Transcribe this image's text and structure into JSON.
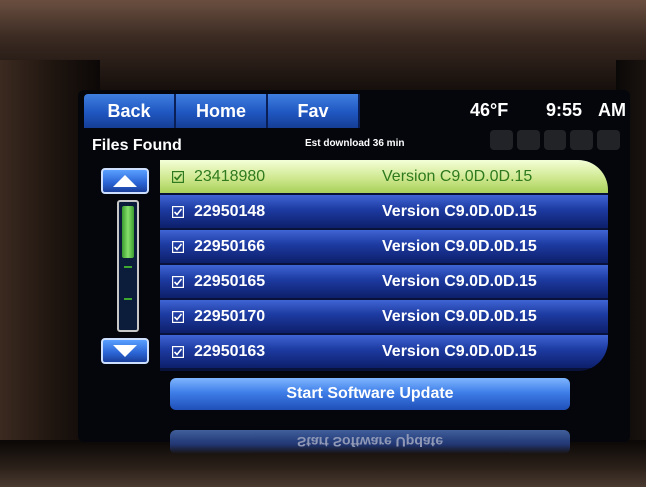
{
  "header": {
    "buttons": {
      "back": "Back",
      "home": "Home",
      "fav": "Fav"
    },
    "temperature": "46°F",
    "time": "9:55",
    "ampm": "AM"
  },
  "subheader": {
    "title": "Files Found",
    "est_download": "Est download 36 min"
  },
  "files": [
    {
      "id": "23418980",
      "version": "Version C9.0D.0D.15",
      "checked": true,
      "selected": true
    },
    {
      "id": "22950148",
      "version": "Version C9.0D.0D.15",
      "checked": true,
      "selected": false
    },
    {
      "id": "22950166",
      "version": "Version C9.0D.0D.15",
      "checked": true,
      "selected": false
    },
    {
      "id": "22950165",
      "version": "Version C9.0D.0D.15",
      "checked": true,
      "selected": false
    },
    {
      "id": "22950170",
      "version": "Version C9.0D.0D.15",
      "checked": true,
      "selected": false
    },
    {
      "id": "22950163",
      "version": "Version C9.0D.0D.15",
      "checked": true,
      "selected": false
    }
  ],
  "footer": {
    "start_label": "Start Software Update"
  },
  "icons": {
    "scroll_up": "triangle-up-icon",
    "scroll_down": "triangle-down-icon",
    "checkbox": "checkbox-checked-icon"
  },
  "colors": {
    "accent_blue": "#2a63d4",
    "selected_green": "#cfe88f",
    "selected_text": "#2f7a1e"
  }
}
